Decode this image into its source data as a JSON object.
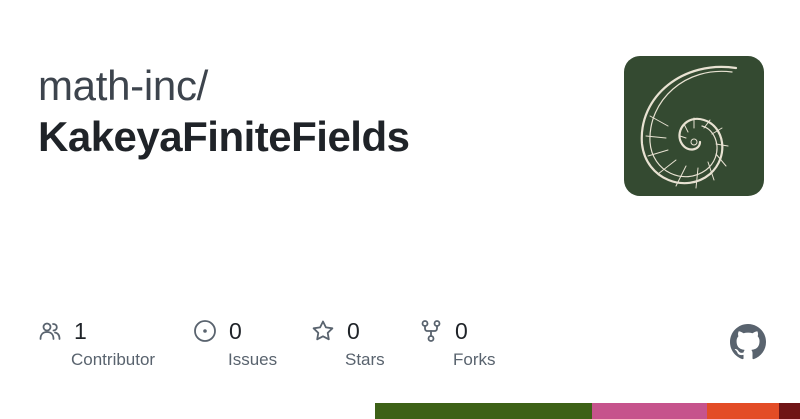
{
  "repo": {
    "owner": "math-inc/",
    "name": "KakeyaFiniteFields"
  },
  "avatar": {
    "background": "#344a31",
    "stroke_color": "#e8e2d2"
  },
  "stats": {
    "contributors": {
      "count": "1",
      "label": "Contributor",
      "icon": "people-icon"
    },
    "issues": {
      "count": "0",
      "label": "Issues",
      "icon": "issue-circle-icon"
    },
    "stars": {
      "count": "0",
      "label": "Stars",
      "icon": "star-icon"
    },
    "forks": {
      "count": "0",
      "label": "Forks",
      "icon": "fork-icon"
    }
  },
  "language_bar": [
    {
      "color": "#3d6117",
      "share": 0.51
    },
    {
      "color": "#c6538c",
      "share": 0.27
    },
    {
      "color": "#e34c26",
      "share": 0.17
    },
    {
      "color": "#701516",
      "share": 0.05
    }
  ],
  "colors": {
    "text_primary": "#1f2328",
    "text_secondary": "#59636e",
    "icon": "#59636e",
    "github_logo": "#59636e"
  }
}
